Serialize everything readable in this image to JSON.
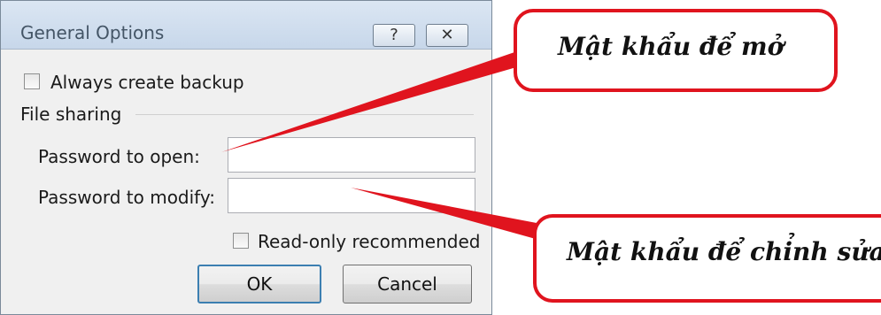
{
  "dialog": {
    "title": "General Options",
    "help_glyph": "?",
    "close_glyph": "✕",
    "backup_label": "Always create backup",
    "backup_checked": false,
    "file_sharing_label": "File sharing",
    "open_label": "Password to open:",
    "open_value": "",
    "modify_label": "Password to modify:",
    "modify_value": "",
    "readonly_label": "Read-only recommended",
    "readonly_checked": false,
    "ok_label": "OK",
    "cancel_label": "Cancel"
  },
  "callouts": {
    "open_note": "Mật khẩu để mở",
    "modify_note": "Mật khẩu để chỉnh sửa"
  },
  "colors": {
    "callout_border": "#e0141e",
    "dialog_bg": "#f0f0f0",
    "titlebar": "#c7d7ea"
  }
}
